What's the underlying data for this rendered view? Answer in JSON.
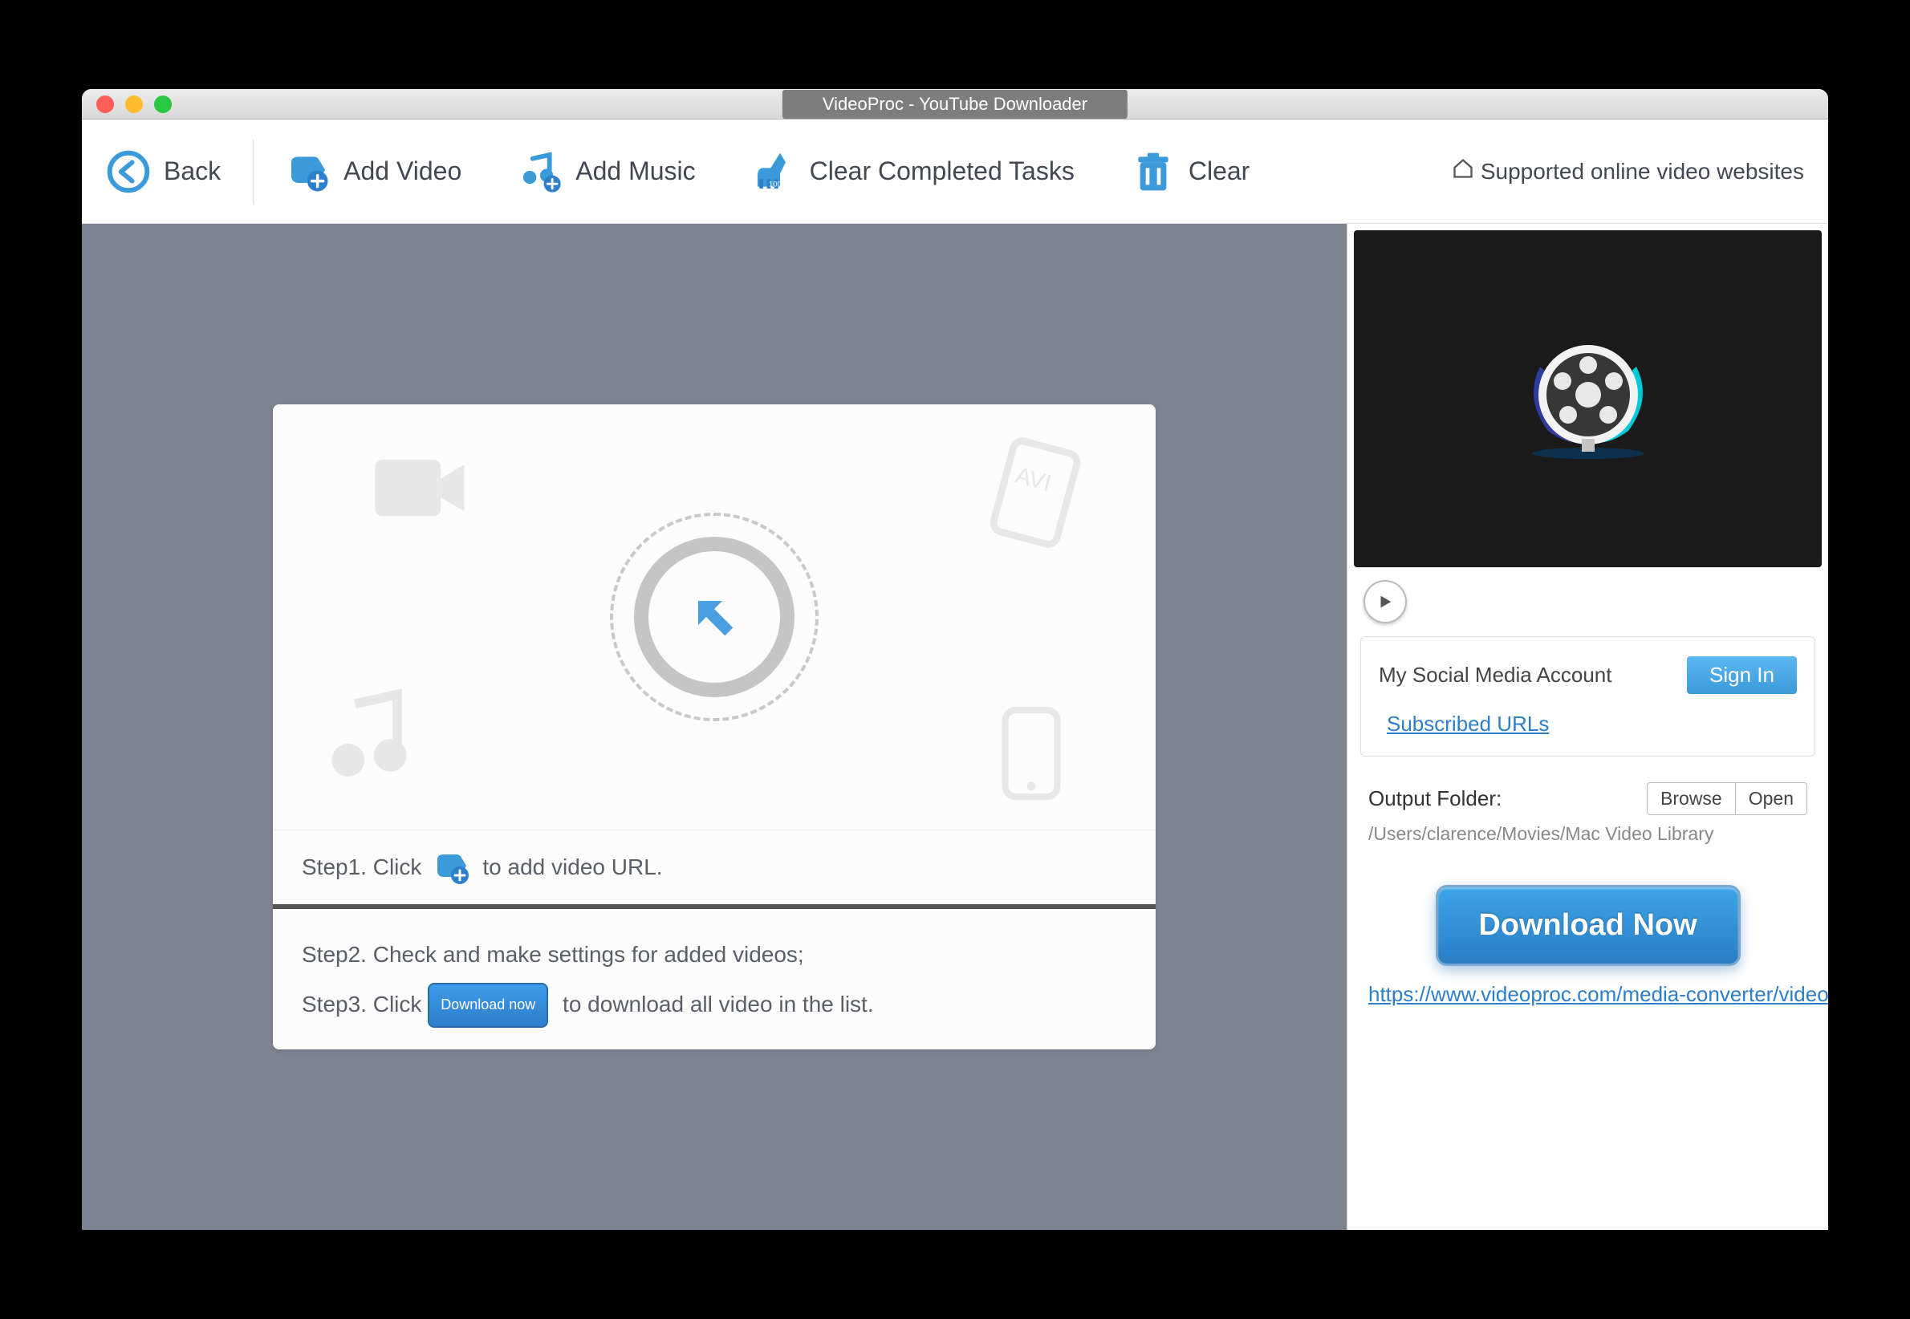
{
  "window": {
    "title": "VideoProc - YouTube Downloader"
  },
  "toolbar": {
    "back": "Back",
    "add_video": "Add Video",
    "add_music": "Add Music",
    "clear_completed": "Clear Completed Tasks",
    "clear": "Clear",
    "supported": "Supported online video websites"
  },
  "steps": {
    "s1_a": "Step1. Click",
    "s1_b": "to add video URL.",
    "s2": "Step2. Check and make settings for added videos;",
    "s3_a": "Step3. Click",
    "s3_chip": "Download now",
    "s3_b": "to download all video in the list."
  },
  "sidebar": {
    "social_label": "My Social Media Account",
    "signin": "Sign In",
    "subscribed": "Subscribed URLs",
    "output_label": "Output Folder:",
    "browse": "Browse",
    "open": "Open",
    "output_path": "/Users/clarence/Movies/Mac Video Library",
    "download_now": "Download Now",
    "footer_link": "https://www.videoproc.com/media-converter/video"
  }
}
